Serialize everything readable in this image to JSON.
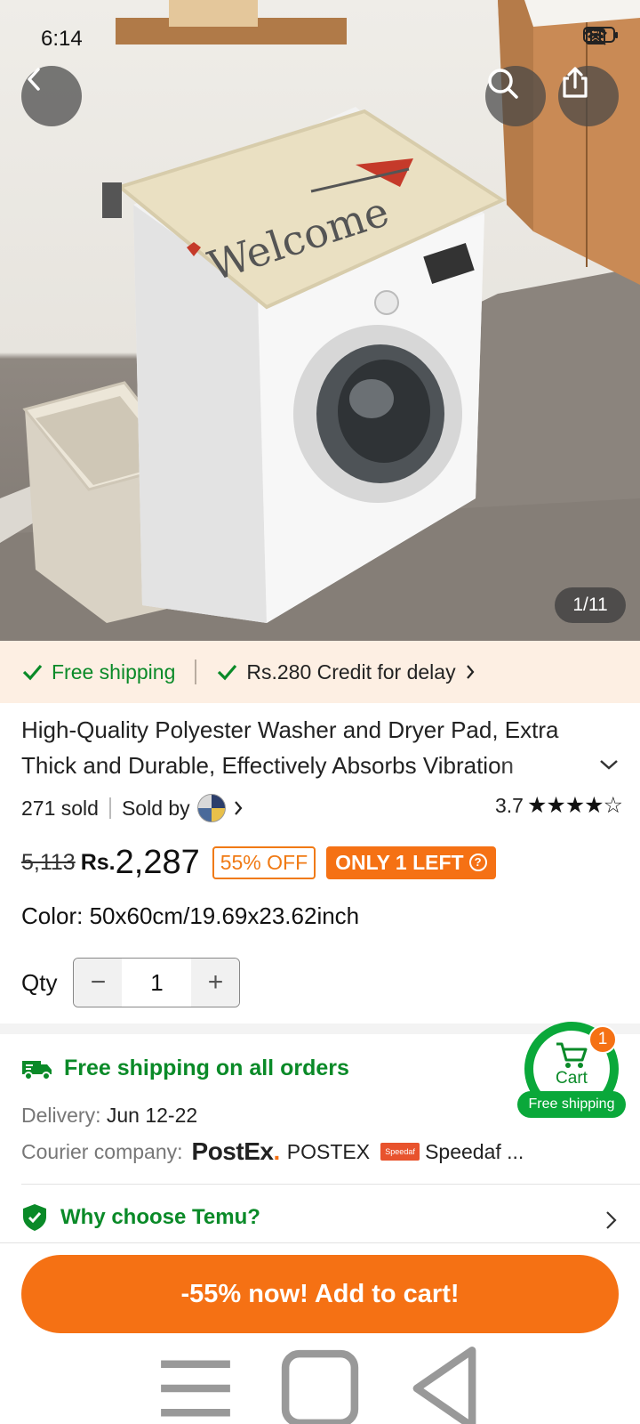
{
  "status": {
    "time": "6:14",
    "battery": "79"
  },
  "hero": {
    "counter": "1/11",
    "mat_text": "Welcome"
  },
  "strip": {
    "free_shipping": "Free shipping",
    "credit": "Rs.280 Credit for delay"
  },
  "product": {
    "title": "High-Quality Polyester Washer and Dryer Pad, Extra Thick and Durable, Effectively Absorbs Vibration",
    "sold": "271 sold",
    "sold_by": "Sold by",
    "rating": "3.7",
    "stars": "★★★★☆",
    "old_price": "5,113",
    "currency": "Rs.",
    "price": "2,287",
    "discount": "55% OFF",
    "stock": "ONLY 1 LEFT",
    "color_label": "Color:",
    "color_value": "50x60cm/19.69x23.62inch",
    "qty_label": "Qty",
    "qty": "1",
    "qty_minus": "−",
    "qty_plus": "+"
  },
  "shipping": {
    "headline": "Free shipping on all orders",
    "delivery_label": "Delivery:",
    "delivery_value": "Jun 12-22",
    "courier_label": "Courier company:",
    "postex_logo": "PostEx",
    "postex_name": "POSTEX",
    "speedaf_logo": "Speedaf",
    "speedaf_name": "Speedaf ..."
  },
  "why": {
    "label": "Why choose Temu?"
  },
  "cart": {
    "label": "Cart",
    "count": "1",
    "free_shipping": "Free shipping"
  },
  "cta": {
    "label": "-55% now! Add to cart!"
  },
  "colors": {
    "accent": "#f57114",
    "green": "#0a8a28",
    "strip_bg": "#fdefe3"
  }
}
